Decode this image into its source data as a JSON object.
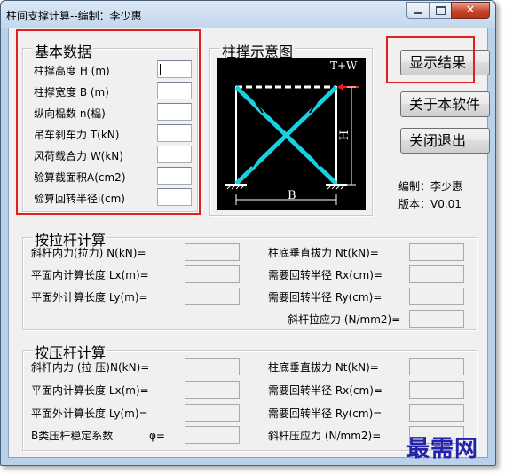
{
  "window": {
    "title": "柱间支撑计算--编制：李少惠"
  },
  "basic": {
    "title": "基本数据",
    "fields": [
      {
        "label": "柱撑高度 H (m)",
        "value": ""
      },
      {
        "label": "柱撑宽度 B (m)",
        "value": ""
      },
      {
        "label": "纵向榀数 n(榀)",
        "value": ""
      },
      {
        "label": "吊车刹车力 T(kN)",
        "value": ""
      },
      {
        "label": "风荷载合力 W(kN)",
        "value": ""
      },
      {
        "label": "验算截面积A(cm2)",
        "value": ""
      },
      {
        "label": "验算回转半径i(cm)",
        "value": ""
      }
    ]
  },
  "diagram": {
    "title": "柱撑示意图",
    "top_label": "T+W",
    "height_label": "H",
    "width_label": "B"
  },
  "buttons": {
    "show_result": "显示结果",
    "about": "关于本软件",
    "exit": "关闭退出"
  },
  "info": {
    "author": "编制：李少惠",
    "version": "版本：V0.01"
  },
  "tension": {
    "title": "按拉杆计算",
    "left": [
      {
        "label": "斜杆内力(拉力) N(kN)=",
        "value": ""
      },
      {
        "label": "平面内计算长度 Lx(m)=",
        "value": ""
      },
      {
        "label": "平面外计算长度 Ly(m)=",
        "value": ""
      }
    ],
    "right": [
      {
        "label": "柱底垂直拔力 Nt(kN)=",
        "value": ""
      },
      {
        "label": "需要回转半径 Rx(cm)=",
        "value": ""
      },
      {
        "label": "需要回转半径 Ry(cm)=",
        "value": ""
      },
      {
        "label": "斜杆拉应力 (N/mm2)=",
        "value": ""
      }
    ]
  },
  "compression": {
    "title": "按压杆计算",
    "left": [
      {
        "label": "斜杆内力 (拉 压)N(kN)=",
        "value": ""
      },
      {
        "label": "平面内计算长度 Lx(m)=",
        "value": ""
      },
      {
        "label": "平面外计算长度 Ly(m)=",
        "value": ""
      },
      {
        "label": "B类压杆稳定系数",
        "value": ""
      }
    ],
    "phi_symbol": "φ=",
    "right": [
      {
        "label": "柱底垂直拔力 Nt(kN)=",
        "value": ""
      },
      {
        "label": "需要回转半径 Rx(cm)=",
        "value": ""
      },
      {
        "label": "需要回转半径 Ry(cm)=",
        "value": ""
      },
      {
        "label": "斜杆压应力 (N/mm2)=",
        "value": ""
      }
    ]
  },
  "watermark": "最需网",
  "colors": {
    "highlight": "#e02020",
    "brace": "#1ad0e0",
    "diagram_bg": "#000000",
    "watermark": "#2222aa"
  }
}
